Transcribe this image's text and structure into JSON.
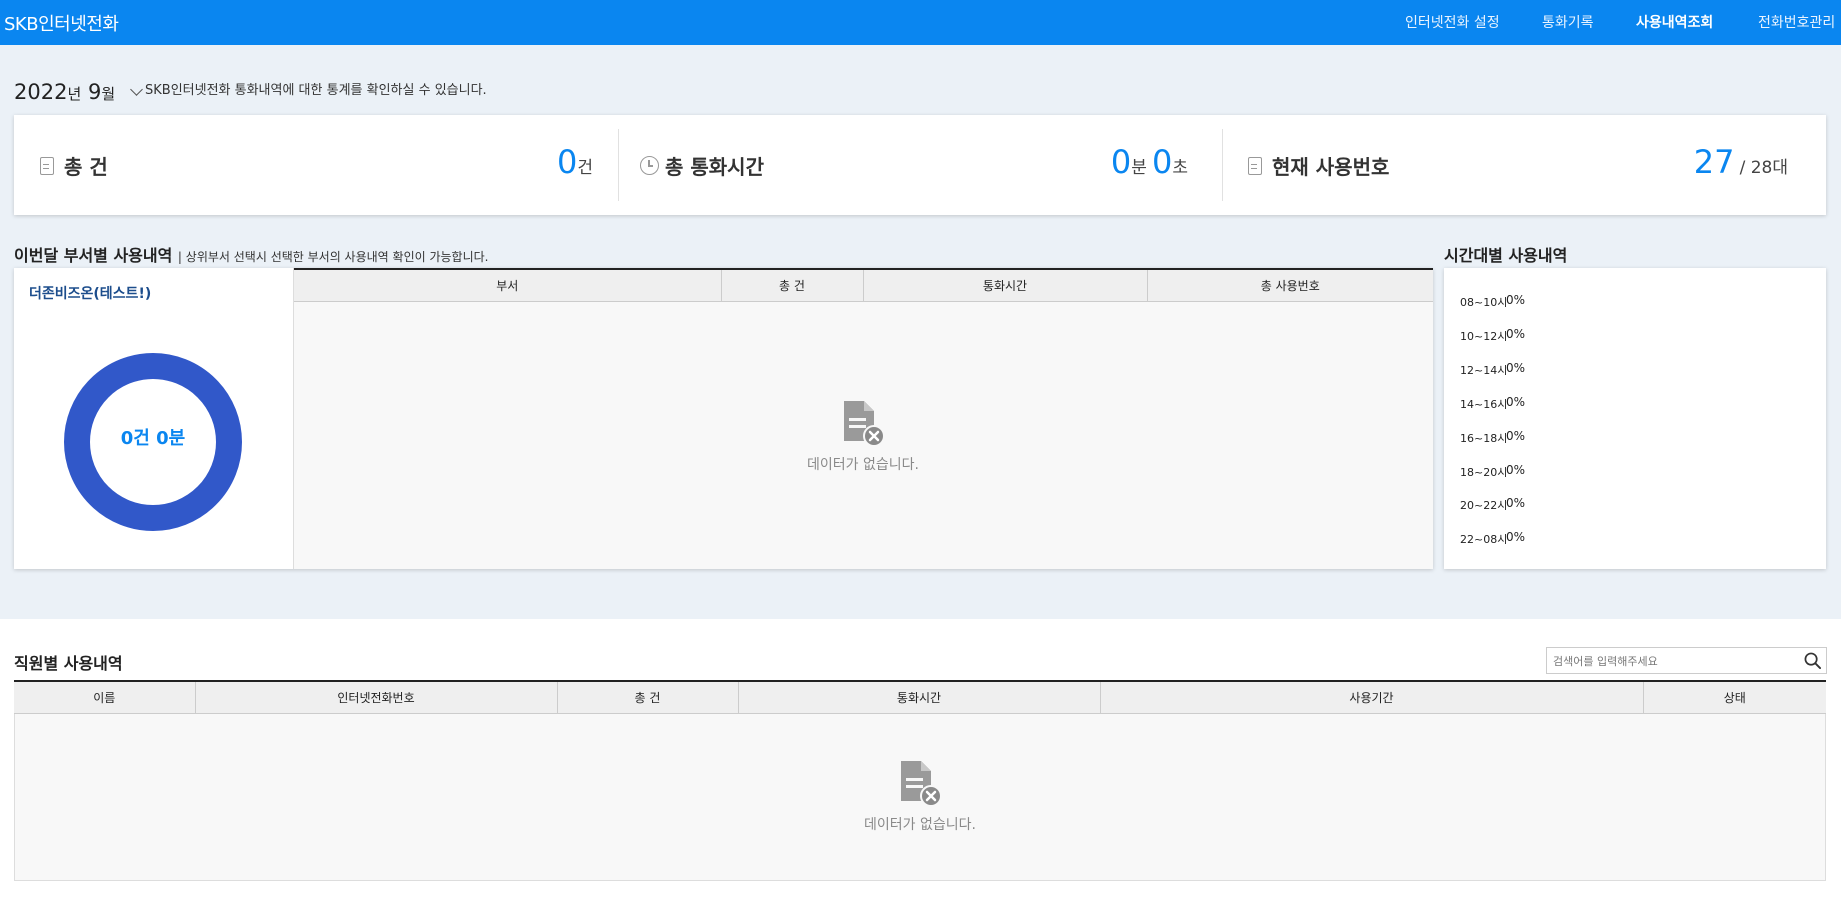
{
  "header": {
    "brand": "SKB인터넷전화",
    "nav": [
      {
        "label": "인터넷전화 설정",
        "active": false
      },
      {
        "label": "통화기록",
        "active": false
      },
      {
        "label": "사용내역조회",
        "active": true
      },
      {
        "label": "전화번호관리",
        "active": false
      }
    ]
  },
  "period": {
    "year": "2022",
    "year_unit": "년",
    "month": "9",
    "month_unit": "월",
    "description": "SKB인터넷전화 통화내역에 대한 통계를 확인하실 수 있습니다."
  },
  "summary": {
    "total_calls": {
      "label": "총 건",
      "value": "0",
      "unit": "건"
    },
    "total_time": {
      "label": "총 통화시간",
      "minutes": "0",
      "minutes_unit": "분",
      "seconds": "0",
      "seconds_unit": "초"
    },
    "current_numbers": {
      "label": "현재 사용번호",
      "value": "27",
      "total": "/ 28대"
    }
  },
  "dept_section": {
    "title": "이번달 부서별 사용내역",
    "subtitle": "| 상위부서 선택시 선택한 부서의 사용내역 확인이 가능합니다.",
    "dept_name": "더존비즈온(테스트!)",
    "donut_label": "0건 0분",
    "columns": [
      "부서",
      "총 건",
      "통화시간",
      "총 사용번호"
    ],
    "empty_text": "데이터가 없습니다."
  },
  "time_section": {
    "title": "시간대별 사용내역",
    "rows": [
      {
        "range": "08~10시",
        "pct": "0%"
      },
      {
        "range": "10~12시",
        "pct": "0%"
      },
      {
        "range": "12~14시",
        "pct": "0%"
      },
      {
        "range": "14~16시",
        "pct": "0%"
      },
      {
        "range": "16~18시",
        "pct": "0%"
      },
      {
        "range": "18~20시",
        "pct": "0%"
      },
      {
        "range": "20~22시",
        "pct": "0%"
      },
      {
        "range": "22~08시",
        "pct": "0%"
      }
    ]
  },
  "staff_section": {
    "title": "직원별 사용내역",
    "search_placeholder": "검색어를 입력해주세요",
    "columns": [
      "이름",
      "인터넷전화번호",
      "총 건",
      "통화시간",
      "사용기간",
      "상태"
    ],
    "empty_text": "데이터가 없습니다."
  },
  "colors": {
    "header_bg": "#0a86f0",
    "accent": "#0a86f0",
    "donut": "#3158c9",
    "page_bg": "#ebf1f7"
  },
  "icons": {
    "doc": "document-icon",
    "clock": "clock-icon",
    "search": "search-icon",
    "empty": "no-data-icon"
  }
}
